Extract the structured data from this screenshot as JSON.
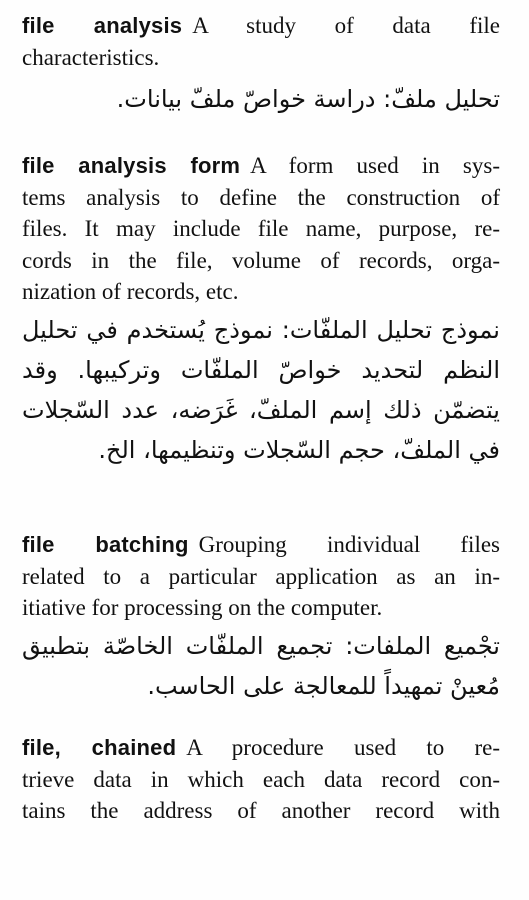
{
  "entries": [
    {
      "term": "file analysis",
      "english_lines": [
        "A study of data file",
        "characteristics."
      ],
      "arabic_lines": [
        "تحليل ملفّ: دراسة خواصّ ملفّ بيانات."
      ]
    },
    {
      "term": "file analysis form",
      "english_lines": [
        "A form used in sys-",
        "tems analysis to define the construction of",
        "files. It may include file name, purpose, re-",
        "cords in the file, volume of records, orga-",
        "nization of records, etc."
      ],
      "arabic_lines": [
        "نموذج تحليل الملفّات: نموذج يُستخدم في تحليل",
        "النظم لتحديد خواصّ الملفّات وتركيبها. وقد",
        "يتضمّن ذلك إسم الملفّ، غَرَضه، عدد السّجلات",
        "في الملفّ، حجم السّجلات وتنظيمها، الخ."
      ]
    },
    {
      "term": "file batching",
      "english_lines": [
        "Grouping individual files",
        "related to a particular application as an in-",
        "itiative for processing on the computer."
      ],
      "arabic_lines": [
        "تجْميع الملفات: تجميع الملفّات الخاصّة بتطبيق",
        "مُعينْ تمهيداً للمعالجة على الحاسب."
      ]
    },
    {
      "term": "file, chained",
      "english_lines": [
        "A procedure used to re-",
        "trieve data in which each data record con-",
        "tains the address of another record with"
      ],
      "arabic_lines": []
    }
  ]
}
